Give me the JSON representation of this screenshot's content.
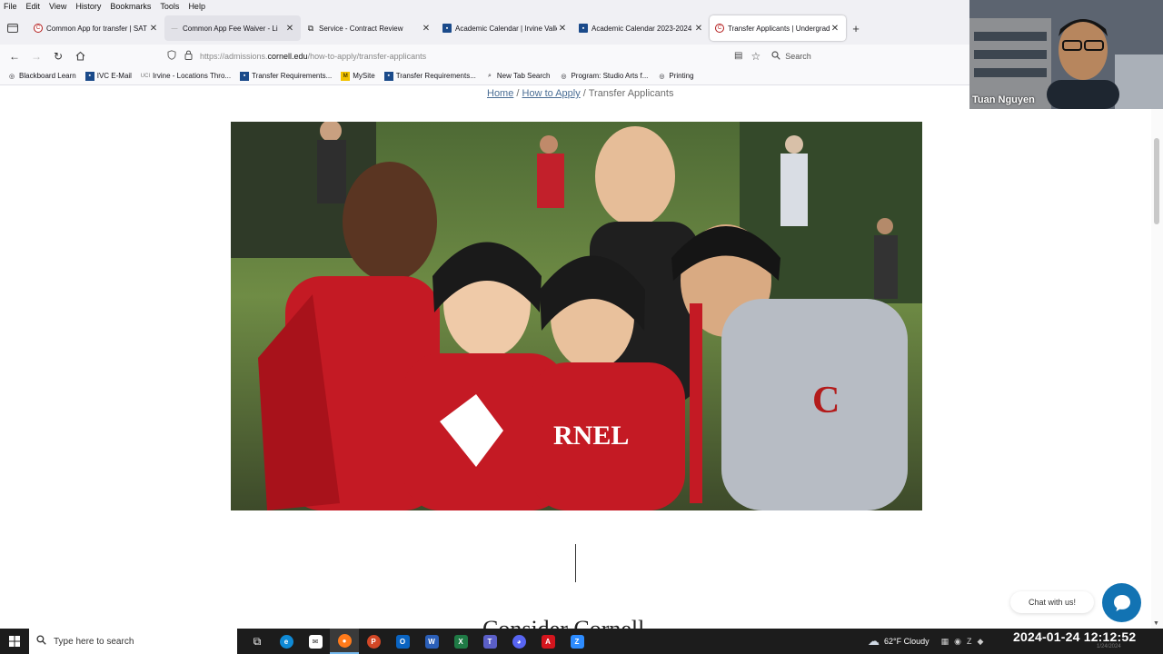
{
  "menu": [
    "File",
    "Edit",
    "View",
    "History",
    "Bookmarks",
    "Tools",
    "Help"
  ],
  "tabs": [
    {
      "title": "Common App for transfer | SAT Sub",
      "favicon": "cornell-seal",
      "favicon_color": "#b31b1b",
      "state": "normal"
    },
    {
      "title": "Common App Fee Waiver - Li",
      "favicon": "dash",
      "favicon_color": "#999999",
      "state": "hover"
    },
    {
      "title": "Service - Contract Review",
      "favicon": "page",
      "favicon_color": "#333333",
      "state": "normal"
    },
    {
      "title": "Academic Calendar | Irvine Valle",
      "favicon": "ivc",
      "favicon_color": "#1a4a8a",
      "state": "normal"
    },
    {
      "title": "Academic Calendar 2023-2024 | I",
      "favicon": "ivc",
      "favicon_color": "#1a4a8a",
      "state": "normal"
    },
    {
      "title": "Transfer Applicants | Undergrad",
      "favicon": "cornell-seal",
      "favicon_color": "#b31b1b",
      "state": "active"
    }
  ],
  "nav": {
    "url_prefix": "https://admissions.",
    "url_domain": "cornell.edu",
    "url_path": "/how-to-apply/transfer-applicants",
    "search_placeholder": "Search"
  },
  "bookmarks": [
    {
      "label": "Blackboard Learn",
      "icon": "globe-icon"
    },
    {
      "label": "IVC E-Mail",
      "icon": "ivc-icon"
    },
    {
      "label": "Irvine - Locations Thro...",
      "icon": "uci-icon"
    },
    {
      "label": "Transfer Requirements...",
      "icon": "ivc-icon"
    },
    {
      "label": "MySite",
      "icon": "mysite-icon"
    },
    {
      "label": "Transfer Requirements...",
      "icon": "ivc-icon"
    },
    {
      "label": "New Tab Search",
      "icon": "search-icon"
    },
    {
      "label": "Program: Studio Arts f...",
      "icon": "globe-icon"
    },
    {
      "label": "Printing",
      "icon": "globe-icon"
    }
  ],
  "page": {
    "breadcrumb": {
      "home": "Home",
      "sep": "/",
      "how": "How to Apply",
      "current": "Transfer Applicants"
    },
    "heading": "Consider Cornell",
    "chat_label": "Chat with us!"
  },
  "video": {
    "name": "Tuan Nguyen"
  },
  "taskbar": {
    "search_placeholder": "Type here to search",
    "weather": "62°F  Cloudy",
    "clock": "2024-01-24 12:12:52",
    "date_small": "1/24/2024"
  },
  "colors": {
    "accent_link": "#4b6e95",
    "chat_blue": "#1273b3",
    "cornell_red": "#b31b1b"
  }
}
